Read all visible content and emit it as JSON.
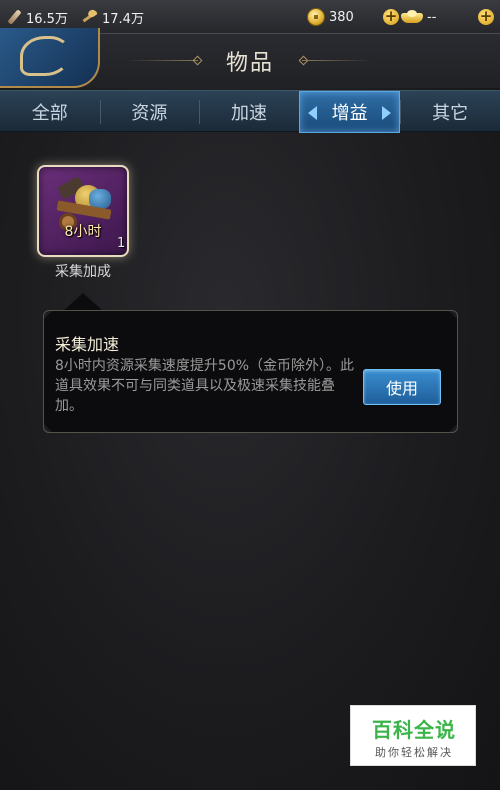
{
  "resources": {
    "wood": {
      "icon": "wood-icon",
      "value": "16.5万"
    },
    "food": {
      "icon": "wheat-icon",
      "value": "17.4万"
    },
    "coins": {
      "icon": "coin-icon",
      "value": "380"
    },
    "ingots": {
      "icon": "ingot-icon",
      "value": "--"
    }
  },
  "header": {
    "title": "物品"
  },
  "tabs": [
    {
      "label": "全部",
      "active": false
    },
    {
      "label": "资源",
      "active": false
    },
    {
      "label": "加速",
      "active": false
    },
    {
      "label": "增益",
      "active": true
    },
    {
      "label": "其它",
      "active": false
    }
  ],
  "item": {
    "icon": "gathering-cart-icon",
    "duration_label": "8小时",
    "count": "1",
    "name": "采集加成"
  },
  "detail": {
    "title": "采集加速",
    "description": "8小时内资源采集速度提升50%（金币除外）。此道具效果不可与同类道具以及极速采集技能叠加。",
    "use_button": "使用"
  },
  "watermark": {
    "main": "百科全说",
    "sub": "助你轻松解决"
  },
  "colors": {
    "active_tab": "#2f6ea6",
    "item_frame": "#6a2f7a",
    "use_button": "#3a8ed0",
    "watermark_green": "#3bb54a"
  }
}
